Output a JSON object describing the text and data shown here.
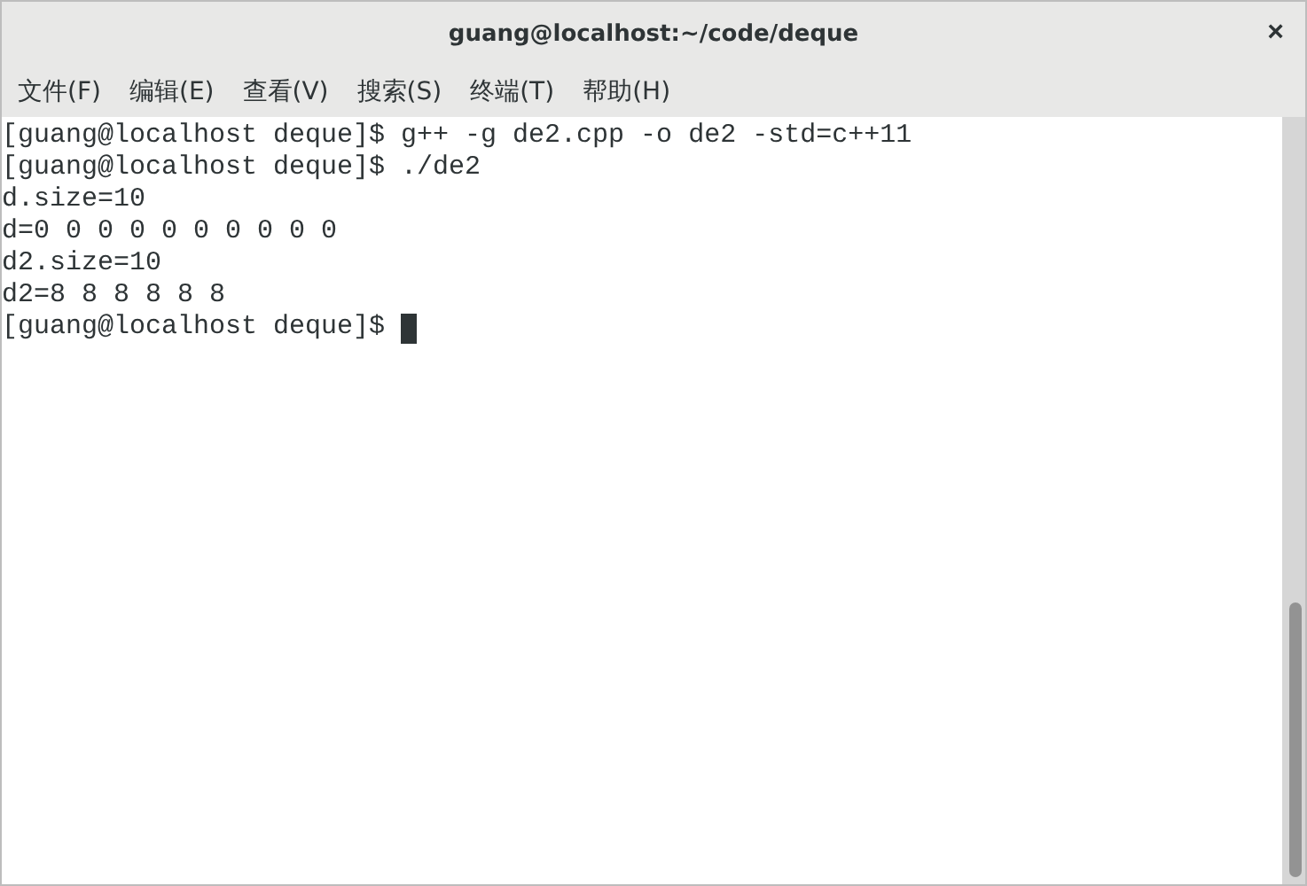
{
  "window": {
    "title": "guang@localhost:~/code/deque",
    "close": "×"
  },
  "menu": [
    "文件(F)",
    "编辑(E)",
    "查看(V)",
    "搜索(S)",
    "终端(T)",
    "帮助(H)"
  ],
  "terminal": {
    "lines": [
      "[guang@localhost deque]$ g++ -g de2.cpp -o de2 -std=c++11",
      "[guang@localhost deque]$ ./de2",
      "d.size=10",
      "d=0 0 0 0 0 0 0 0 0 0",
      "d2.size=10",
      "d2=8 8 8 8 8 8"
    ],
    "prompt": {
      "text": "[guang@localhost deque]$ ",
      "cursor": true
    }
  }
}
